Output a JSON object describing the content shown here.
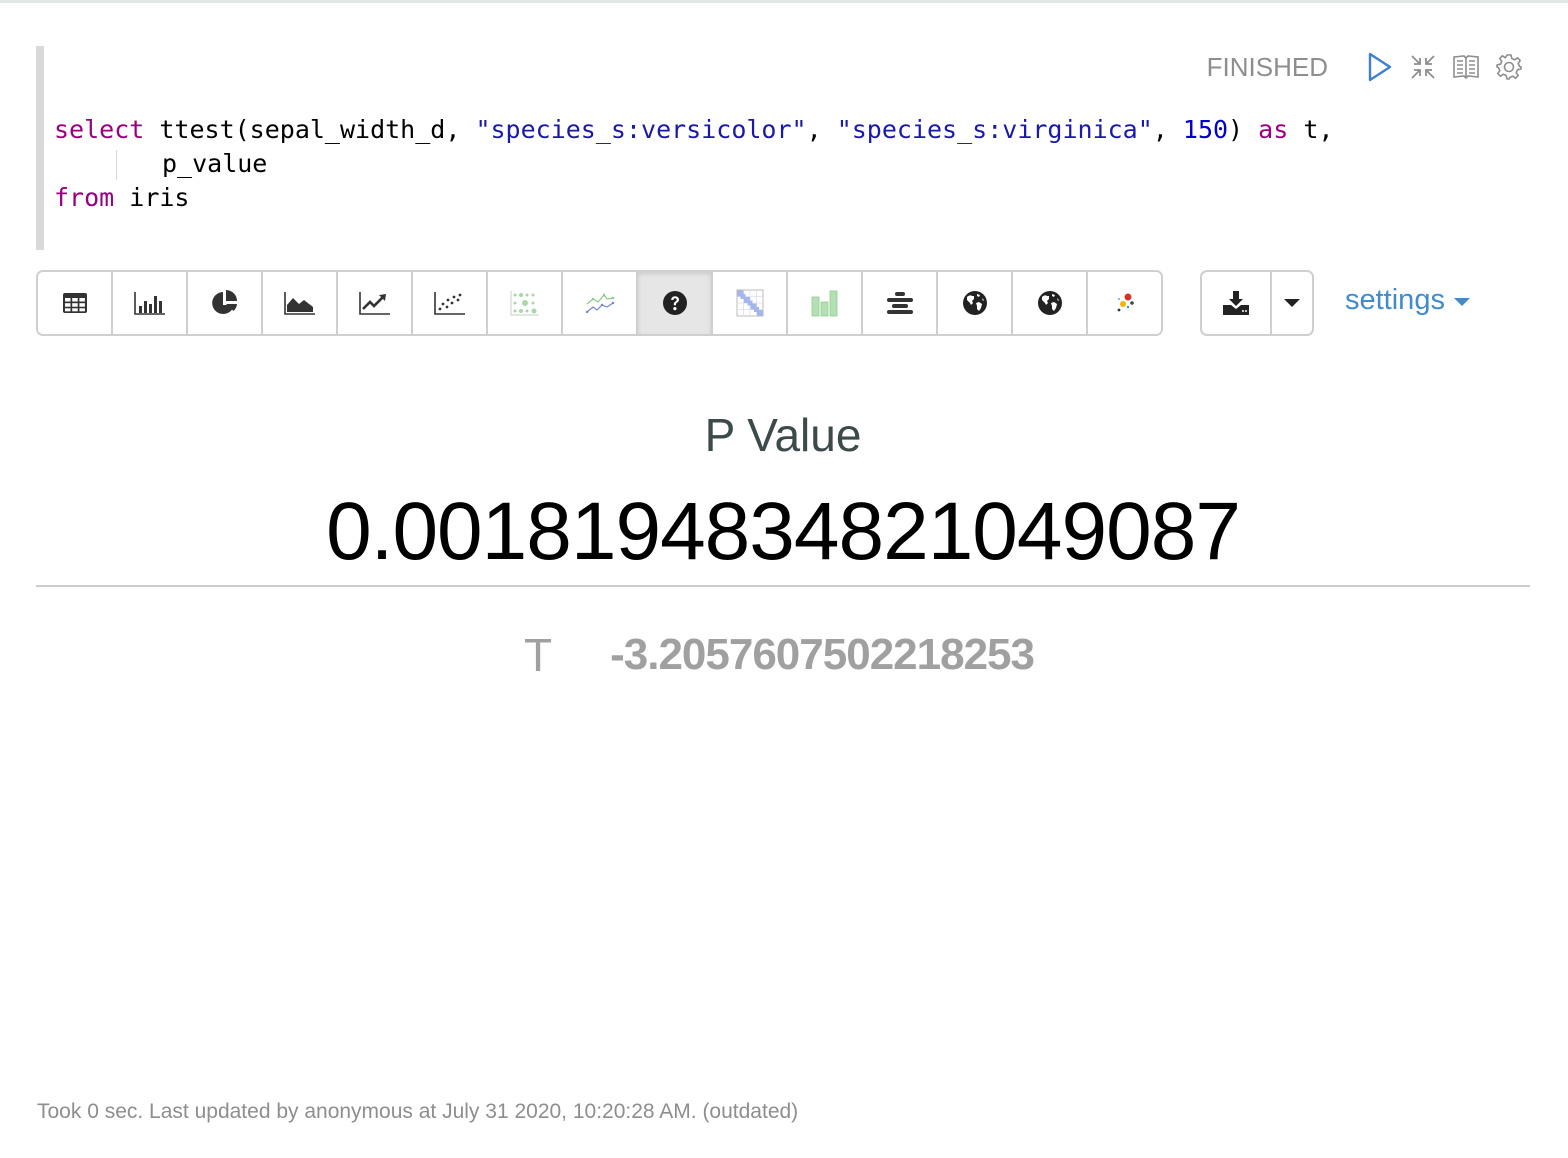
{
  "paragraph": {
    "status": "FINISHED",
    "status_icons": [
      "run-icon",
      "collapse-icon",
      "book-icon",
      "gear-icon"
    ],
    "code": {
      "line1": {
        "keyword_select": "select",
        "func": " ttest(sepal_width_d, ",
        "str1": "\"species_s:versicolor\"",
        "comma1": ", ",
        "str2": "\"species_s:virginica\"",
        "comma2": ", ",
        "num": "150",
        "close": ") ",
        "keyword_as": "as",
        "tail": " t,"
      },
      "line2": "p_value",
      "line3": {
        "keyword_from": "from",
        "table": " iris"
      }
    },
    "toolbar": {
      "buttons": [
        {
          "name": "table",
          "icon": "table-icon"
        },
        {
          "name": "bar-chart",
          "icon": "bar-chart-icon"
        },
        {
          "name": "pie-chart",
          "icon": "pie-chart-icon"
        },
        {
          "name": "area-chart",
          "icon": "area-chart-icon"
        },
        {
          "name": "line-chart",
          "icon": "line-chart-icon"
        },
        {
          "name": "scatter-chart",
          "icon": "scatter-chart-icon"
        },
        {
          "name": "bubble-chart",
          "icon": "bubble-chart-icon"
        },
        {
          "name": "multi-line-chart",
          "icon": "multi-line-chart-icon"
        },
        {
          "name": "number",
          "icon": "question-circle-icon",
          "active": true
        },
        {
          "name": "heatmap",
          "icon": "heatmap-icon"
        },
        {
          "name": "column-chart",
          "icon": "column-chart-icon"
        },
        {
          "name": "funnel",
          "icon": "funnel-icon"
        },
        {
          "name": "map",
          "icon": "globe-icon"
        },
        {
          "name": "heat-map-geo",
          "icon": "globe-icon"
        },
        {
          "name": "network",
          "icon": "network-dots-icon"
        }
      ],
      "download_icon": "download-icon",
      "dropdown_icon": "caret-down-icon"
    },
    "settings_label": "settings",
    "result": {
      "primary_label": "P Value",
      "primary_value": "0.0018194834821049087",
      "secondary_label": "T",
      "secondary_value": "-3.2057607502218253"
    },
    "footer": "Took 0 sec. Last updated by anonymous at July 31 2020, 10:20:28 AM. (outdated)"
  },
  "colors": {
    "accent": "#428bca",
    "run_icon": "#3f7fcf",
    "keyword": "#990080",
    "string": "#1a1aa6",
    "number": "#0000cd"
  }
}
